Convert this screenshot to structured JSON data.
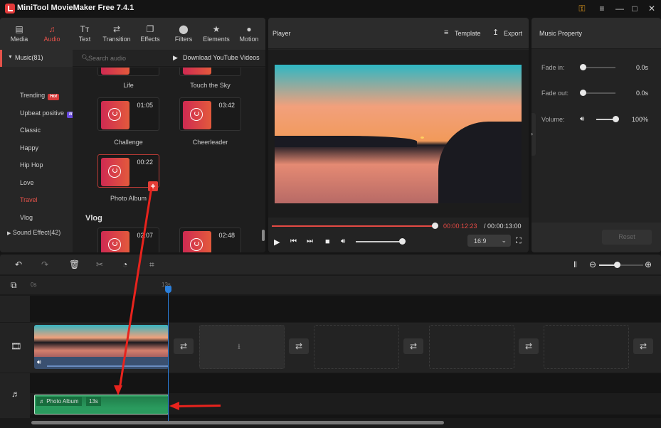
{
  "app": {
    "title": "MiniTool MovieMaker Free 7.4.1",
    "window_controls": [
      "key-icon",
      "menu-icon",
      "minimize-icon",
      "maximize-icon",
      "close-icon"
    ]
  },
  "library": {
    "tabs": [
      {
        "label": "Media",
        "icon": "media-icon",
        "active": false
      },
      {
        "label": "Audio",
        "icon": "audio-icon",
        "active": true
      },
      {
        "label": "Text",
        "icon": "text-icon",
        "active": false
      },
      {
        "label": "Transition",
        "icon": "transition-icon",
        "active": false
      },
      {
        "label": "Effects",
        "icon": "effects-icon",
        "active": false
      },
      {
        "label": "Filters",
        "icon": "filters-icon",
        "active": false
      },
      {
        "label": "Elements",
        "icon": "elements-icon",
        "active": false
      },
      {
        "label": "Motion",
        "icon": "motion-icon",
        "active": false
      }
    ],
    "search_placeholder": "Search audio",
    "download_label": "Download YouTube Videos",
    "music_group": "Music(81)",
    "categories": [
      {
        "label": "Trending",
        "badge": "Hot",
        "active": false
      },
      {
        "label": "Upbeat positive",
        "badge": "New",
        "active": false
      },
      {
        "label": "Classic",
        "active": false
      },
      {
        "label": "Happy",
        "active": false
      },
      {
        "label": "Hip Hop",
        "active": false
      },
      {
        "label": "Love",
        "active": false
      },
      {
        "label": "Travel",
        "active": true
      },
      {
        "label": "Vlog",
        "active": false
      }
    ],
    "sound_effect_group": "Sound Effect(42)",
    "tracks": [
      {
        "name": "Life",
        "duration": ""
      },
      {
        "name": "Touch the Sky",
        "duration": ""
      },
      {
        "name": "Challenge",
        "duration": "01:05"
      },
      {
        "name": "Cheerleader",
        "duration": "03:42"
      },
      {
        "name": "Photo Album",
        "duration": "00:22",
        "selected": true
      }
    ],
    "vlog_heading": "Vlog",
    "vlog_tracks": [
      {
        "duration": "02:07"
      },
      {
        "duration": "02:48"
      }
    ]
  },
  "player": {
    "title": "Player",
    "template_label": "Template",
    "export_label": "Export",
    "current_time": "00:00:12:23",
    "total_time": "/ 00:00:13:00",
    "progress": 0.99,
    "volume": 1.0,
    "aspect_ratio": "16:9"
  },
  "music_property": {
    "title": "Music Property",
    "fade_in_label": "Fade in:",
    "fade_in_value": "0.0s",
    "fade_out_label": "Fade out:",
    "fade_out_value": "0.0s",
    "volume_label": "Volume:",
    "volume_value": "100%",
    "reset_label": "Reset"
  },
  "timeline": {
    "ruler_start": "0s",
    "ruler_playhead": "13s",
    "audio_clip_name": "Photo Album",
    "audio_clip_duration": "13s",
    "zoom_level": 0.4
  }
}
